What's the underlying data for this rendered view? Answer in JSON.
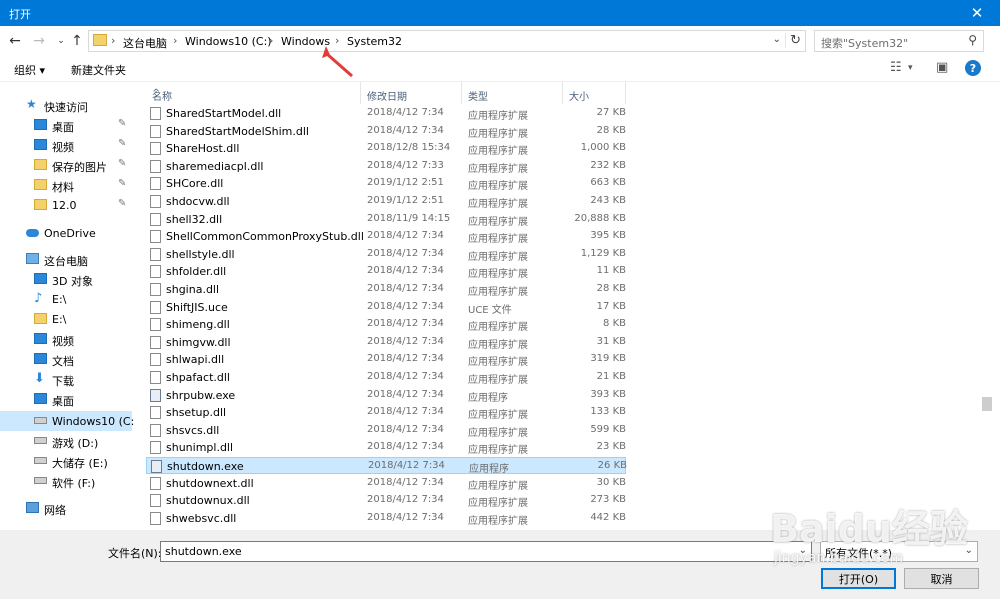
{
  "window": {
    "title": "打开",
    "close_glyph": "✕"
  },
  "address_bar": {
    "crumbs": [
      "这台电脑",
      "Windows10 (C:)",
      "Windows",
      "System32"
    ],
    "separator": "›"
  },
  "search": {
    "placeholder": "搜索\"System32\""
  },
  "toolbar": {
    "organize": "组织 ▾",
    "new_folder": "新建文件夹"
  },
  "sidebar": {
    "items": [
      {
        "label": "快速访问",
        "icon": "star-icon"
      },
      {
        "label": "桌面",
        "icon": "desktop-icon",
        "pinned": true
      },
      {
        "label": "视频",
        "icon": "video-icon",
        "pinned": true
      },
      {
        "label": "保存的图片",
        "icon": "folder-icon",
        "pinned": true
      },
      {
        "label": "材料",
        "icon": "folder-icon",
        "pinned": true
      },
      {
        "label": "12.0",
        "icon": "folder-icon",
        "pinned": true
      },
      {
        "label": "OneDrive",
        "icon": "cloud-icon"
      },
      {
        "label": "这台电脑",
        "icon": "computer-icon"
      },
      {
        "label": "3D 对象",
        "icon": "3d-objects-icon"
      },
      {
        "label": "E:\\",
        "icon": "music-icon"
      },
      {
        "label": "E:\\",
        "icon": "folder-icon"
      },
      {
        "label": "视频",
        "icon": "video-icon"
      },
      {
        "label": "文档",
        "icon": "documents-icon"
      },
      {
        "label": "下载",
        "icon": "download-icon"
      },
      {
        "label": "桌面",
        "icon": "desktop-icon"
      },
      {
        "label": "Windows10 (C:)",
        "icon": "drive-icon",
        "selected": true
      },
      {
        "label": "游戏 (D:)",
        "icon": "drive-icon"
      },
      {
        "label": "大储存 (E:)",
        "icon": "drive-icon"
      },
      {
        "label": "软件 (F:)",
        "icon": "drive-icon"
      },
      {
        "label": "网络",
        "icon": "network-icon"
      }
    ]
  },
  "columns": {
    "name": "名称",
    "date": "修改日期",
    "type": "类型",
    "size": "大小"
  },
  "files": [
    {
      "name": "SharedStartModel.dll",
      "date": "2018/4/12 7:34",
      "type": "应用程序扩展",
      "size": "27 KB"
    },
    {
      "name": "SharedStartModelShim.dll",
      "date": "2018/4/12 7:34",
      "type": "应用程序扩展",
      "size": "28 KB"
    },
    {
      "name": "ShareHost.dll",
      "date": "2018/12/8 15:34",
      "type": "应用程序扩展",
      "size": "1,000 KB"
    },
    {
      "name": "sharemediacpl.dll",
      "date": "2018/4/12 7:33",
      "type": "应用程序扩展",
      "size": "232 KB"
    },
    {
      "name": "SHCore.dll",
      "date": "2019/1/12 2:51",
      "type": "应用程序扩展",
      "size": "663 KB"
    },
    {
      "name": "shdocvw.dll",
      "date": "2019/1/12 2:51",
      "type": "应用程序扩展",
      "size": "243 KB"
    },
    {
      "name": "shell32.dll",
      "date": "2018/11/9 14:15",
      "type": "应用程序扩展",
      "size": "20,888 KB"
    },
    {
      "name": "ShellCommonCommonProxyStub.dll",
      "date": "2018/4/12 7:34",
      "type": "应用程序扩展",
      "size": "395 KB"
    },
    {
      "name": "shellstyle.dll",
      "date": "2018/4/12 7:34",
      "type": "应用程序扩展",
      "size": "1,129 KB"
    },
    {
      "name": "shfolder.dll",
      "date": "2018/4/12 7:34",
      "type": "应用程序扩展",
      "size": "11 KB"
    },
    {
      "name": "shgina.dll",
      "date": "2018/4/12 7:34",
      "type": "应用程序扩展",
      "size": "28 KB"
    },
    {
      "name": "ShiftJIS.uce",
      "date": "2018/4/12 7:34",
      "type": "UCE 文件",
      "size": "17 KB"
    },
    {
      "name": "shimeng.dll",
      "date": "2018/4/12 7:34",
      "type": "应用程序扩展",
      "size": "8 KB"
    },
    {
      "name": "shimgvw.dll",
      "date": "2018/4/12 7:34",
      "type": "应用程序扩展",
      "size": "31 KB"
    },
    {
      "name": "shlwapi.dll",
      "date": "2018/4/12 7:34",
      "type": "应用程序扩展",
      "size": "319 KB"
    },
    {
      "name": "shpafact.dll",
      "date": "2018/4/12 7:34",
      "type": "应用程序扩展",
      "size": "21 KB"
    },
    {
      "name": "shrpubw.exe",
      "date": "2018/4/12 7:34",
      "type": "应用程序",
      "size": "393 KB"
    },
    {
      "name": "shsetup.dll",
      "date": "2018/4/12 7:34",
      "type": "应用程序扩展",
      "size": "133 KB"
    },
    {
      "name": "shsvcs.dll",
      "date": "2018/4/12 7:34",
      "type": "应用程序扩展",
      "size": "599 KB"
    },
    {
      "name": "shunimpl.dll",
      "date": "2018/4/12 7:34",
      "type": "应用程序扩展",
      "size": "23 KB"
    },
    {
      "name": "shutdown.exe",
      "date": "2018/4/12 7:34",
      "type": "应用程序",
      "size": "26 KB",
      "selected": true
    },
    {
      "name": "shutdownext.dll",
      "date": "2018/4/12 7:34",
      "type": "应用程序扩展",
      "size": "30 KB"
    },
    {
      "name": "shutdownux.dll",
      "date": "2018/4/12 7:34",
      "type": "应用程序扩展",
      "size": "273 KB"
    },
    {
      "name": "shwebsvc.dll",
      "date": "2018/4/12 7:34",
      "type": "应用程序扩展",
      "size": "442 KB"
    }
  ],
  "bottom": {
    "filename_label": "文件名(N):",
    "filename_value": "shutdown.exe",
    "filetype_value": "所有文件(*.*)",
    "open_button": "打开(O)",
    "cancel_button": "取消"
  },
  "watermark": {
    "main": "Baidu经验",
    "sub": "jingyan.baidu.com"
  },
  "colors": {
    "titlebar": "#0078d7",
    "selection": "#cce8ff",
    "annotation_arrow": "#e23b3b"
  }
}
